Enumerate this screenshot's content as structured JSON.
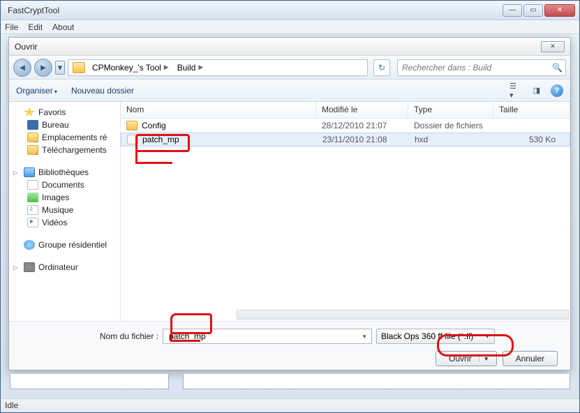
{
  "window": {
    "title": "FastCryptTool"
  },
  "menu": {
    "file": "File",
    "edit": "Edit",
    "about": "About"
  },
  "dialog": {
    "title": "Ouvrir",
    "breadcrumb": {
      "seg1": "CPMonkey_'s Tool",
      "seg2": "Build"
    },
    "search_placeholder": "Rechercher dans : Build",
    "toolbar": {
      "organize": "Organiser",
      "new_folder": "Nouveau dossier"
    },
    "sidebar": {
      "favorites": "Favoris",
      "desktop": "Bureau",
      "recent": "Emplacements ré",
      "downloads": "Téléchargements",
      "libraries": "Bibliothèques",
      "documents": "Documents",
      "images": "Images",
      "music": "Musique",
      "videos": "Vidéos",
      "homegroup": "Groupe résidentiel",
      "computer": "Ordinateur"
    },
    "columns": {
      "name": "Nom",
      "modified": "Modifié le",
      "type": "Type",
      "size": "Taille"
    },
    "rows": [
      {
        "name": "Config",
        "modified": "28/12/2010 21:07",
        "type": "Dossier de fichiers",
        "size": "",
        "kind": "folder"
      },
      {
        "name": "patch_mp",
        "modified": "23/11/2010 21:08",
        "type": "hxd",
        "size": "530 Ko",
        "kind": "file"
      }
    ],
    "footer": {
      "filename_label": "Nom du fichier :",
      "filename_value": "patch_mp",
      "filter": "Black Ops 360 ff file (*.ff)",
      "open": "Ouvrir",
      "cancel": "Annuler"
    }
  },
  "statusbar": "Idle"
}
